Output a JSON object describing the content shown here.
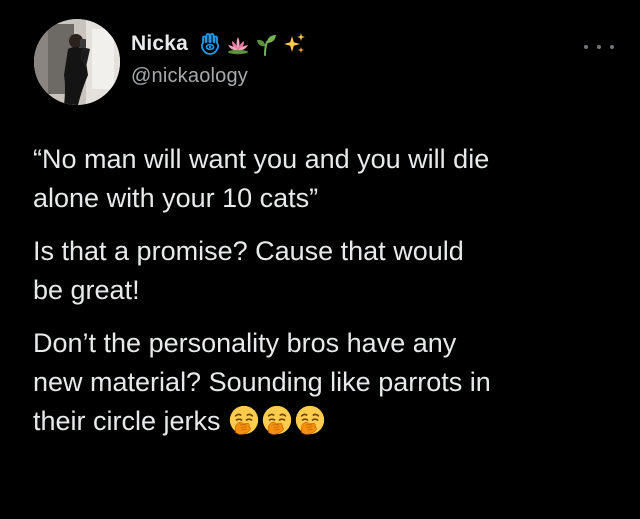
{
  "tweet": {
    "author": {
      "display_name": "Nicka",
      "handle": "@nickaology",
      "name_emojis": [
        "hamsa-icon",
        "lotus-icon",
        "seedling-icon",
        "sparkles-icon"
      ],
      "avatar": "profile-photo"
    },
    "more_icon": "more-horizontal-icon",
    "paragraphs": [
      "“No man will want you and you will die\nalone with your 10 cats”",
      "Is that a promise? Cause that would\nbe great!",
      "Don’t the personality bros have any\nnew material? Sounding like parrots in\ntheir circle jerks"
    ],
    "trailing_emojis": [
      "yawning-face-icon",
      "yawning-face-icon",
      "yawning-face-icon"
    ],
    "colors": {
      "background": "#000000",
      "text": "#e7e9ea",
      "handle": "#a7aaad",
      "hamsa": "#1d9bf0",
      "lotus": "#f4a3c1",
      "seedling": "#77b255",
      "sparkles": "#ffcc4d"
    }
  }
}
